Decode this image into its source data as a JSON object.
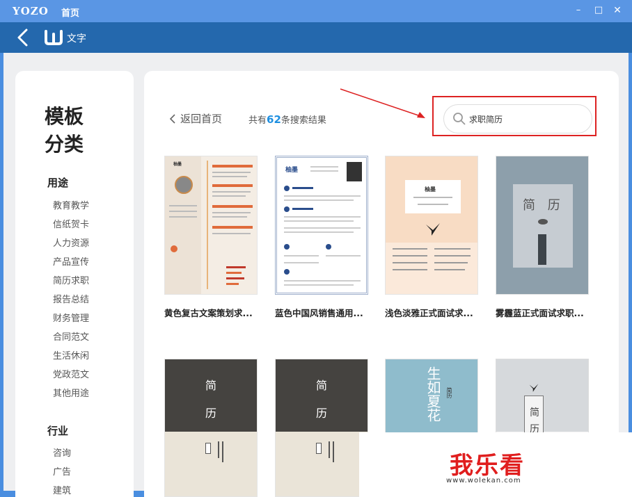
{
  "titlebar": {
    "brand": "YOZO",
    "home": "首页",
    "minimize": "–",
    "maximize": "□",
    "close": "✕"
  },
  "appbar": {
    "title": "文字"
  },
  "sidebar": {
    "heading": "模板分类",
    "sections": [
      {
        "title": "用途",
        "items": [
          "教育教学",
          "信纸贺卡",
          "人力资源",
          "产品宣传",
          "简历求职",
          "报告总结",
          "财务管理",
          "合同范文",
          "生活休闲",
          "党政范文",
          "其他用途"
        ]
      },
      {
        "title": "行业",
        "items": [
          "咨询",
          "广告",
          "建筑"
        ]
      }
    ]
  },
  "main": {
    "back_label": "返回首页",
    "result_prefix": "共有",
    "result_count": "62",
    "result_suffix": "条搜索结果",
    "search_value": "求职简历",
    "cards": [
      {
        "title": "黄色复古文案策划求...",
        "thumb": {
          "name": "柚墨"
        }
      },
      {
        "title": "蓝色中国风销售通用...",
        "thumb": {
          "name": "柚墨"
        }
      },
      {
        "title": "浅色淡雅正式面试求...",
        "thumb": {
          "name": "柚墨"
        }
      },
      {
        "title": "雾霾蓝正式面试求职...",
        "thumb": {
          "label": "简 历"
        }
      },
      {
        "title": "",
        "thumb": {
          "label1": "简",
          "label2": "历"
        }
      },
      {
        "title": "",
        "thumb": {
          "label1": "简",
          "label2": "历"
        }
      },
      {
        "title": "",
        "thumb": {
          "label1": "生如夏花",
          "label2": "简历"
        }
      },
      {
        "title": "",
        "thumb": {
          "label1": "简",
          "label2": "历"
        }
      }
    ]
  },
  "watermark": {
    "brand": "我乐看",
    "url": "www.wolekan.com"
  },
  "colors": {
    "titlebar": "#5a96e4",
    "appbar": "#2468ad",
    "accent": "#1e8fe0",
    "annotation_red": "#d22222"
  }
}
